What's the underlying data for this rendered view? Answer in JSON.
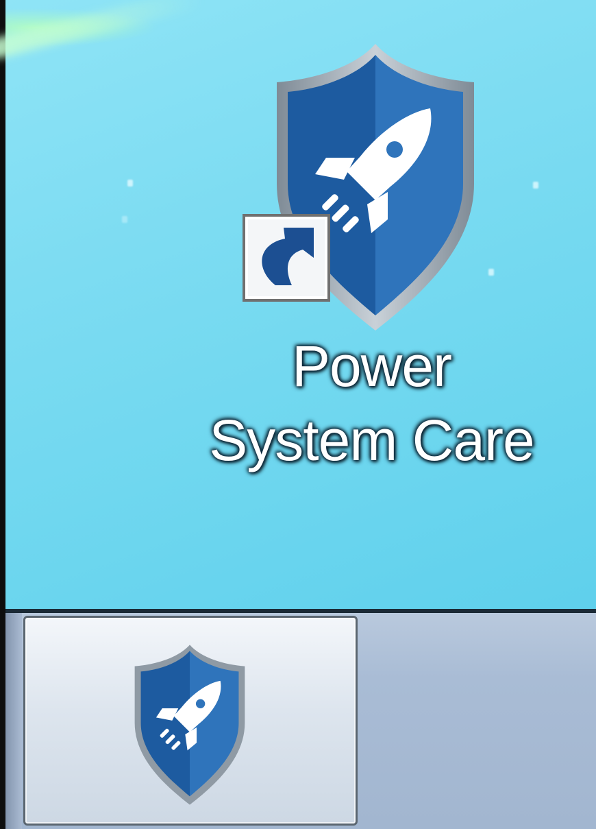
{
  "desktop": {
    "icon": {
      "name": "Power System Care",
      "label_line1": "Power",
      "label_line2": "System Care",
      "icon_name": "shield-rocket-icon",
      "shortcut_overlay": "shortcut-arrow-icon"
    }
  },
  "taskbar": {
    "pinned_apps": [
      {
        "name": "Power System Care",
        "icon_name": "shield-rocket-icon"
      }
    ]
  },
  "colors": {
    "shield_dark": "#1f5fa6",
    "shield_light": "#3a83c8",
    "shield_rim": "#9aa6b0",
    "desktop_bg": "#7ddcf2",
    "taskbar_bg": "#a9bcd5"
  }
}
